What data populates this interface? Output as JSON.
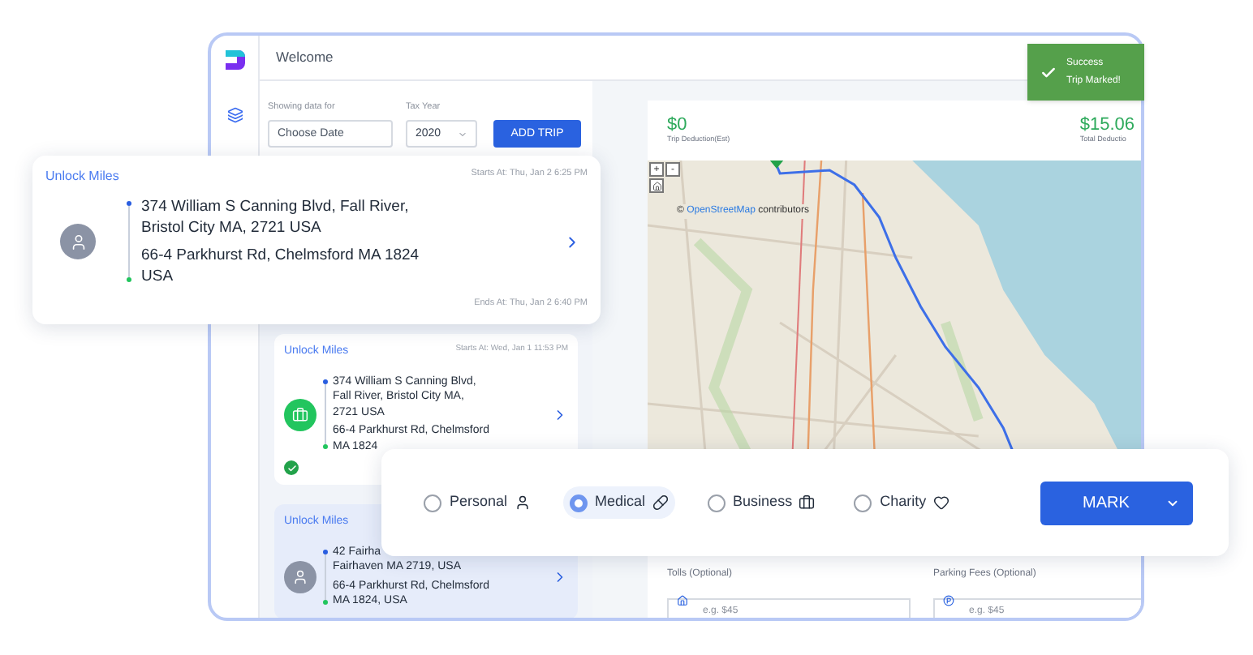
{
  "header": {
    "title": "Welcome"
  },
  "filters": {
    "date_label": "Showing data for",
    "date_placeholder": "Choose Date",
    "year_label": "Tax Year",
    "year_value": "2020",
    "add_button": "ADD TRIP"
  },
  "trips": [
    {
      "label": "Unlock Miles",
      "starts": "Starts At: Wed, Jan 1 11:53 PM",
      "origin_lines": [
        "374 William S Canning Blvd,",
        "Fall River, Bristol City MA,",
        "2721 USA"
      ],
      "destination_lines": [
        "66-4 Parkhurst Rd, Chelmsford",
        "MA 1824"
      ],
      "kind": "business",
      "marked": true,
      "selected": false
    },
    {
      "label": "Unlock Miles",
      "origin_lines": [
        "42 Fairha",
        "Fairhaven MA 2719, USA"
      ],
      "destination_lines": [
        "66-4 Parkhurst Rd, Chelmsford",
        "MA 1824, USA"
      ],
      "kind": "personal",
      "marked": false,
      "selected": true
    }
  ],
  "stats": [
    {
      "value": "$0",
      "label": "Trip Deduction(Est)"
    },
    {
      "value": "$15.06",
      "label": "Total Deductio"
    }
  ],
  "map": {
    "controls": [
      "+",
      "-"
    ],
    "attribution_prefix": "©",
    "attribution_link": "OpenStreetMap",
    "attribution_suffix": "contributors"
  },
  "expenses": [
    {
      "label": "Tolls (Optional)",
      "placeholder": "e.g. $45",
      "kind": "tolls"
    },
    {
      "label": "Parking Fees (Optional)",
      "placeholder": "e.g. $45",
      "kind": "parking"
    }
  ],
  "toast": {
    "title": "Success",
    "message": "Trip Marked!"
  },
  "featured_trip": {
    "label": "Unlock Miles",
    "starts": "Starts At: Thu, Jan 2 6:25 PM",
    "origin": "374 William S Canning Blvd, Fall River, Bristol City MA, 2721 USA",
    "destination": "66-4 Parkhurst Rd, Chelmsford MA 1824 USA",
    "ends": "Ends At: Thu, Jan 2 6:40 PM",
    "kind": "personal"
  },
  "mark_bar": {
    "options": [
      {
        "label": "Personal",
        "kind": "personal",
        "selected": false
      },
      {
        "label": "Medical",
        "kind": "medical",
        "selected": true
      },
      {
        "label": "Business",
        "kind": "business",
        "selected": false
      },
      {
        "label": "Charity",
        "kind": "charity",
        "selected": false
      }
    ],
    "button": "MARK"
  }
}
